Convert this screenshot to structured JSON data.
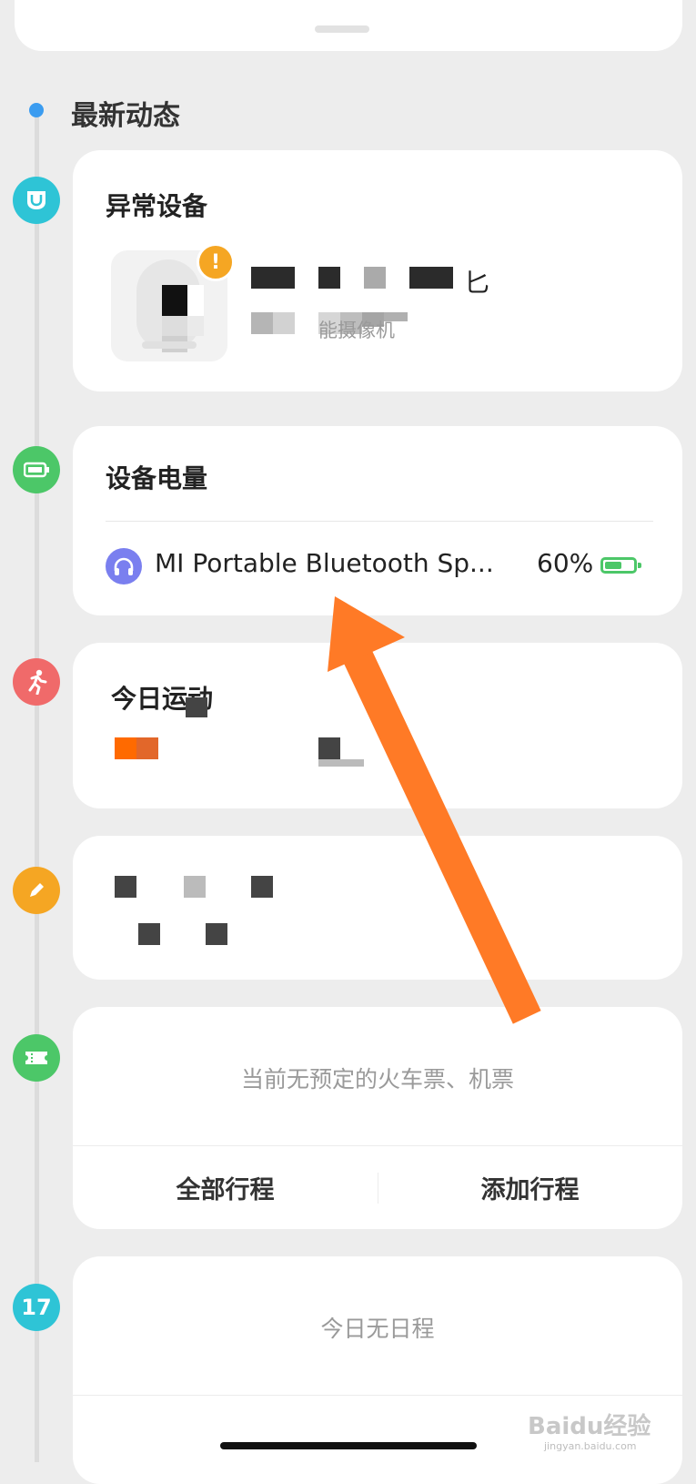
{
  "section": {
    "title": "最新动态"
  },
  "abnormal": {
    "title": "异常设备",
    "device_name_tail": "匕",
    "device_type_tail": "能摄像机",
    "warning_mark": "!"
  },
  "battery": {
    "title": "设备电量",
    "device": "MI Portable Bluetooth Sp...",
    "percent": "60%",
    "level": 0.6
  },
  "sport": {
    "title": "今日运动"
  },
  "trip": {
    "empty_text": "当前无预定的火车票、机票",
    "btn_all": "全部行程",
    "btn_add": "添加行程"
  },
  "schedule": {
    "day_number": "17",
    "empty_text": "今日无日程"
  },
  "watermark": {
    "brand": "Bai",
    "brand2": "du",
    "brand3": "经验",
    "url": "jingyan.baidu.com"
  },
  "colors": {
    "accent_blue": "#3b9cf0",
    "teal": "#2ec4d6",
    "green": "#4cc768",
    "red": "#f06a6a",
    "orange_node": "#f5a623",
    "purple": "#7a7fef",
    "arrow": "#ff7a26"
  }
}
